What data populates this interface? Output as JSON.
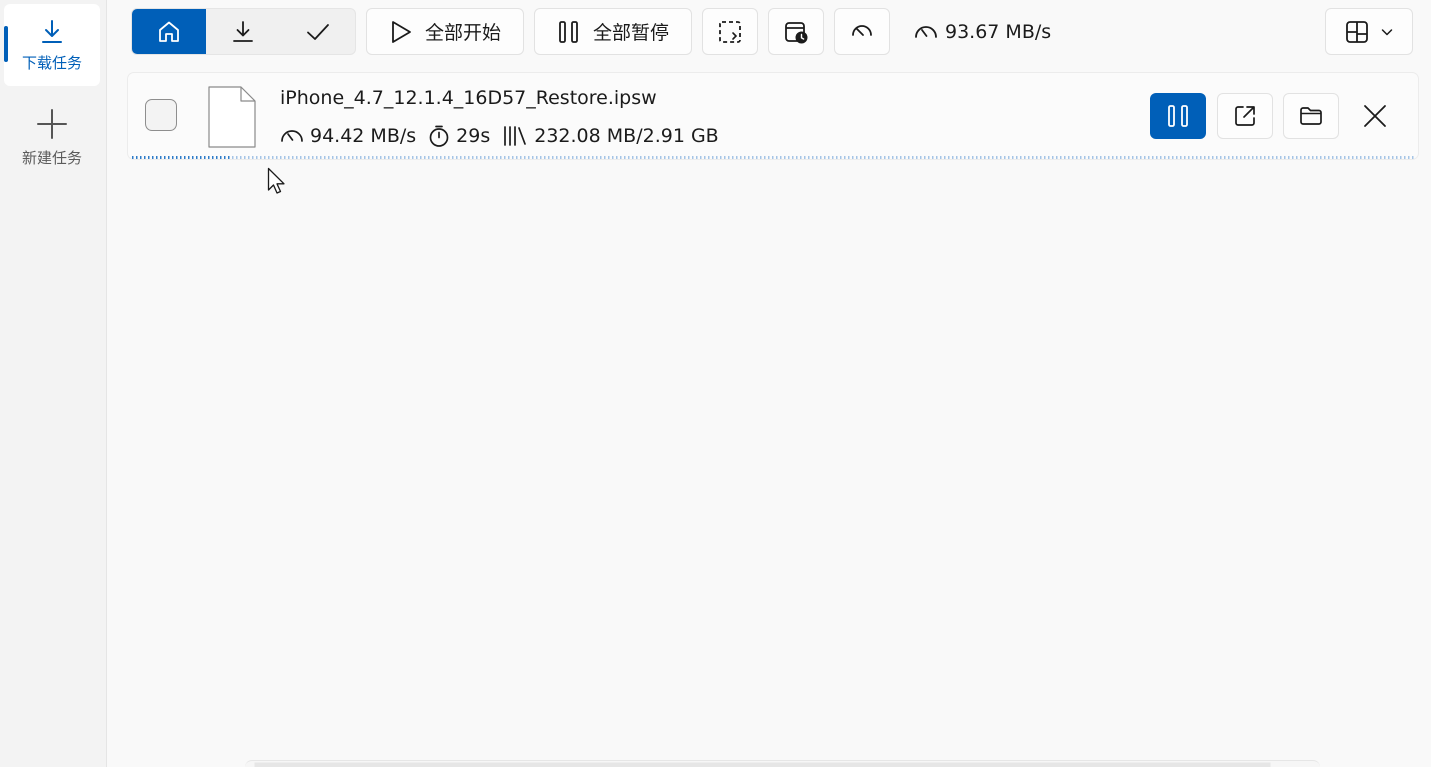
{
  "sidebar": {
    "items": [
      {
        "label": "下载任务",
        "icon": "download-icon",
        "active": true
      },
      {
        "label": "新建任务",
        "icon": "plus-icon",
        "active": false
      }
    ]
  },
  "toolbar": {
    "filters": [
      {
        "icon": "home-icon",
        "active": true
      },
      {
        "icon": "download-icon",
        "active": false
      },
      {
        "icon": "checkmark-icon",
        "active": false
      }
    ],
    "start_all_label": "全部开始",
    "pause_all_label": "全部暂停",
    "total_speed": "93.67 MB/s",
    "accent_color": "#005fb8"
  },
  "task": {
    "file_name": "iPhone_4.7_12.1.4_16D57_Restore.ipsw",
    "speed": "94.42 MB/s",
    "remaining_time": "29s",
    "size_progress": "232.08 MB/2.91 GB",
    "progress_fraction": 0.078
  }
}
